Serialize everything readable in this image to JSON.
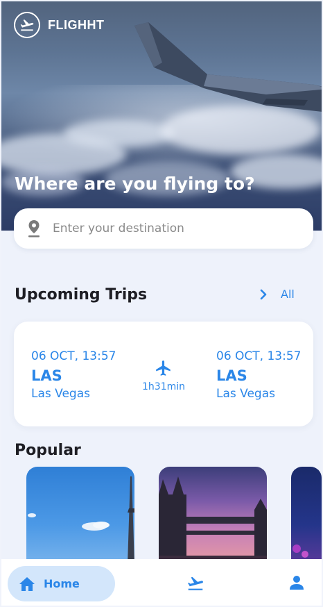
{
  "brand": {
    "name": "FLIGHHT",
    "logo_icon": "plane-takeoff-icon"
  },
  "hero": {
    "title": "Where are you flying to?"
  },
  "search": {
    "placeholder": "Enter your destination",
    "icon": "location-pin-icon"
  },
  "upcoming": {
    "title": "Upcoming Trips",
    "all_label": "All",
    "trip": {
      "departure": {
        "datetime": "06 OCT, 13:57",
        "code": "LAS",
        "city": "Las Vegas"
      },
      "arrival": {
        "datetime": "06 OCT, 13:57",
        "code": "LAS",
        "city": "Las Vegas"
      },
      "duration": "1h31min"
    }
  },
  "popular": {
    "title": "Popular",
    "cards": [
      "paris-eiffel-tower-image",
      "london-tower-bridge-image",
      "city-night-image"
    ]
  },
  "nav": {
    "home_label": "Home",
    "items": [
      "home-icon",
      "flights-icon",
      "profile-icon"
    ]
  },
  "colors": {
    "accent": "#2a86e8",
    "nav_active_bg": "#d3e6fb",
    "background": "#eef2fb",
    "text_dark": "#1e1e24"
  }
}
